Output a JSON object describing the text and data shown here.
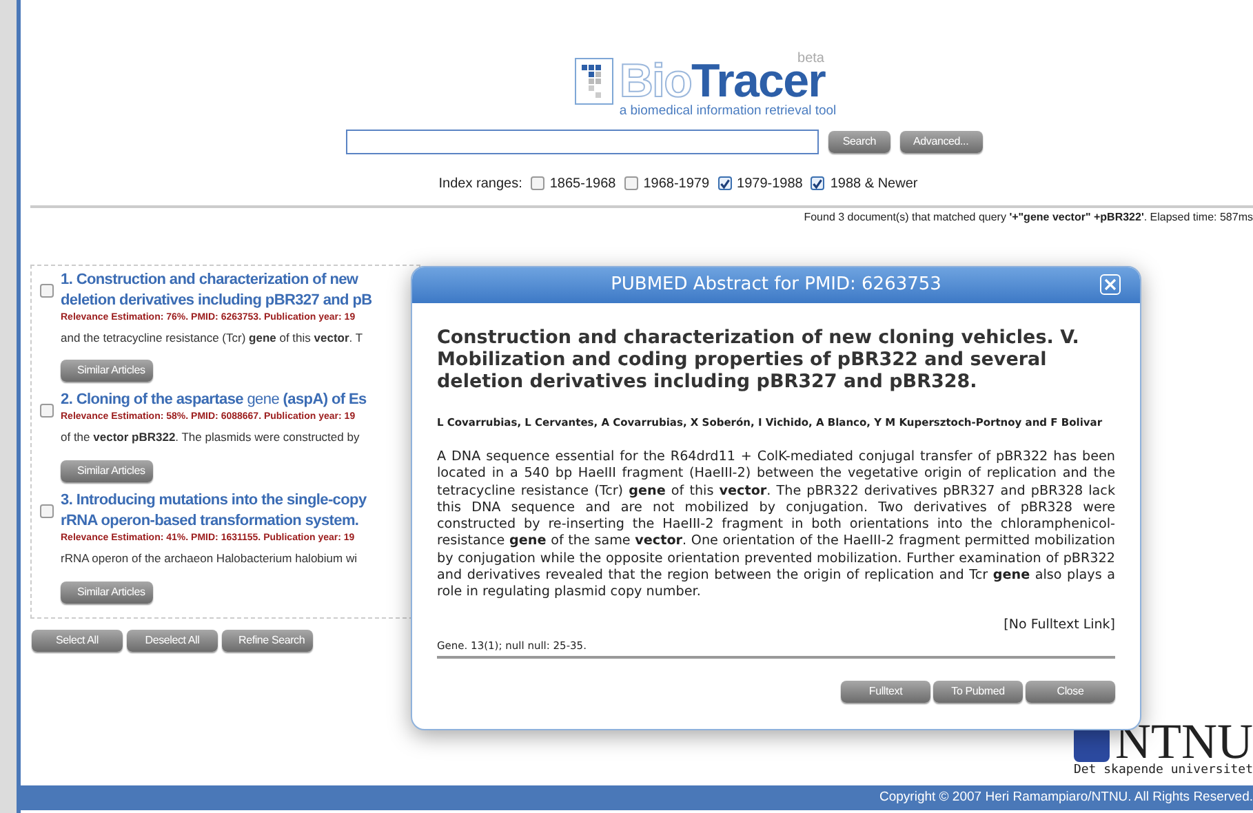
{
  "logo": {
    "name_light": "Bio",
    "name_bold": "Tracer",
    "badge": "beta",
    "tagline": "a biomedical information retrieval tool"
  },
  "search": {
    "buttons": [
      "Search",
      "Advanced..."
    ]
  },
  "index_ranges": {
    "label": "Index ranges:",
    "options": [
      {
        "label": "1865-1968",
        "checked": false
      },
      {
        "label": "1968-1979",
        "checked": false
      },
      {
        "label": "1979-1988",
        "checked": true
      },
      {
        "label": "1988 & Newer",
        "checked": true
      }
    ]
  },
  "result_summary": "Found 3 document(s) that matched query **'+\"gene vector\" +pBR322'**. Elapsed time: 587ms",
  "results": [
    {
      "checked": false,
      "title_lines": [
        "**1. Construction and characterization of new**",
        "**deletion derivatives including pBR327 and pB**"
      ],
      "meta": "Relevance Estimation: 76%. PMID: 6263753. Publication year: 19",
      "snippet": "and the tetracycline resistance (Tcr) **gene** of this **vector**. T",
      "button": "Similar Articles"
    },
    {
      "checked": false,
      "title_lines": [
        "**2. Cloning of the aspartase** gene **(aspA) of Es**"
      ],
      "meta": "Relevance Estimation: 58%. PMID: 6088667. Publication year: 19",
      "snippet": "of the **vector pBR322**. The plasmids were constructed by",
      "button": "Similar Articles"
    },
    {
      "checked": false,
      "title_lines": [
        "**3. Introducing mutations into the single-copy**",
        "**rRNA operon-based transformation system.**"
      ],
      "meta": "Relevance Estimation: 41%. PMID: 1631155. Publication year: 19",
      "snippet": "rRNA operon of the archaeon Halobacterium halobium wi",
      "button": "Similar Articles"
    }
  ],
  "result_buttons": [
    "Select All",
    "Deselect All",
    "Refine Search"
  ],
  "ntnu": {
    "name": "NTNU",
    "slogan": "Det skapende universitet"
  },
  "footer": "Copyright © 2007 Heri Ramampiaro/NTNU. All Rights Reserved.",
  "dialog": {
    "title": "PUBMED Abstract for PMID: 6263753",
    "article_title": "Construction and characterization of new cloning vehicles. V. Mobilization and coding properties of pBR322 and several deletion derivatives including pBR327 and pBR328.",
    "authors": "L Covarrubias, L Cervantes, A Covarrubias, X Soberón, I Vichido, A Blanco, Y M Kupersztoch-Portnoy and F Bolivar",
    "abstract": "A DNA sequence essential for the R64drd11 + ColK-mediated conjugal transfer of pBR322 has been located in a 540 bp HaeIII fragment (HaeIII-2) between the vegetative origin of replication and the tetracycline resistance (Tcr) **gene** of this **vector**. The pBR322 derivatives pBR327 and pBR328 lack this DNA sequence and are not mobilized by conjugation. Two derivatives of pBR328 were constructed by re-inserting the HaeIII-2 fragment in both orientations into the chloramphenicol-resistance **gene** of the same **vector**. One orientation of the HaeIII-2 fragment permitted mobilization by conjugation while the opposite orientation prevented mobilization. Further examination of pBR322 and derivatives revealed that the region between the origin of replication and Tcr **gene** also plays a role in regulating plasmid copy number.",
    "fulltext_link": "[No Fulltext Link]",
    "citation": "Gene. 13(1); null null: 25-35.",
    "buttons": [
      "Fulltext",
      "To Pubmed",
      "Close"
    ]
  }
}
